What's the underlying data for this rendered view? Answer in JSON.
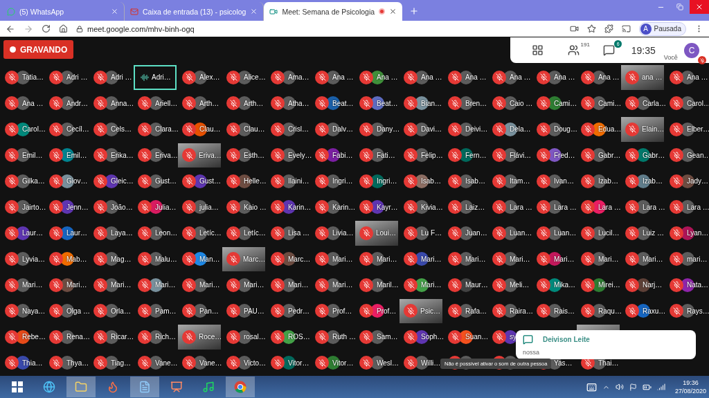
{
  "browser": {
    "tabs": [
      {
        "title": "(5) WhatsApp",
        "kind": "chat",
        "selected": false,
        "recording": false
      },
      {
        "title": "Caixa de entrada (13) - psicolog",
        "kind": "mail",
        "selected": false,
        "recording": false
      },
      {
        "title": "Meet: Semana de Psicologia",
        "kind": "meet",
        "selected": true,
        "recording": true
      }
    ],
    "url": "meet.google.com/mhv-binh-ogq",
    "profile": {
      "initial": "A",
      "label": "Pausada"
    }
  },
  "meeting": {
    "recording_label": "GRAVANDO",
    "participants_count": "191",
    "chat_badge": "6",
    "time": "19:35",
    "self": {
      "initial": "C",
      "label": "Você"
    },
    "grid": [
      [
        {
          "name": "Tatia…",
          "kind": "photo"
        },
        {
          "name": "Adri …",
          "kind": "photo"
        },
        {
          "name": "Adri …",
          "kind": "photo"
        },
        {
          "name": "Adri…",
          "kind": "speaking"
        },
        {
          "name": "Alex…",
          "kind": "photo"
        },
        {
          "name": "Alice…",
          "kind": "photo"
        },
        {
          "name": "Ama…",
          "kind": "photo"
        },
        {
          "name": "Ana …",
          "kind": "photo"
        },
        {
          "name": "Ana …",
          "kind": "letter",
          "color": "#3f8f3a"
        },
        {
          "name": "Ana …",
          "kind": "photo"
        },
        {
          "name": "Ana …",
          "kind": "photo"
        },
        {
          "name": "Ana …",
          "kind": "photo"
        },
        {
          "name": "Ana …",
          "kind": "photo"
        },
        {
          "name": "Ana …",
          "kind": "photo"
        },
        {
          "name": "ana …",
          "kind": "video"
        },
        {
          "name": "Ana …",
          "kind": "photo"
        }
      ],
      [
        {
          "name": "Ana …",
          "kind": "photo"
        },
        {
          "name": "Andr…",
          "kind": "photo"
        },
        {
          "name": "Anna…",
          "kind": "photo"
        },
        {
          "name": "Ariell…",
          "kind": "photo"
        },
        {
          "name": "Arth…",
          "kind": "photo"
        },
        {
          "name": "Arth…",
          "kind": "photo"
        },
        {
          "name": "Atha…",
          "kind": "photo"
        },
        {
          "name": "Beat…",
          "kind": "letter",
          "color": "#1a5fa8"
        },
        {
          "name": "Beat…",
          "kind": "letter",
          "color": "#5c6bc0"
        },
        {
          "name": "Bian…",
          "kind": "letter",
          "color": "#78909c"
        },
        {
          "name": "Bren…",
          "kind": "photo"
        },
        {
          "name": "Caio …",
          "kind": "photo"
        },
        {
          "name": "Cami…",
          "kind": "letter",
          "color": "#2e7d32"
        },
        {
          "name": "Cami…",
          "kind": "photo"
        },
        {
          "name": "Carla…",
          "kind": "photo"
        },
        {
          "name": "Carol…",
          "kind": "photo"
        }
      ],
      [
        {
          "name": "Carol…",
          "kind": "letter",
          "color": "#00897b"
        },
        {
          "name": "Cecíl…",
          "kind": "photo"
        },
        {
          "name": "Cels…",
          "kind": "photo"
        },
        {
          "name": "Clara…",
          "kind": "photo"
        },
        {
          "name": "Clau…",
          "kind": "letter",
          "color": "#e65100"
        },
        {
          "name": "Clau…",
          "kind": "photo"
        },
        {
          "name": "Crisl…",
          "kind": "photo"
        },
        {
          "name": "Dalv…",
          "kind": "photo"
        },
        {
          "name": "Dany…",
          "kind": "photo"
        },
        {
          "name": "Davi…",
          "kind": "photo"
        },
        {
          "name": "Deivi…",
          "kind": "photo"
        },
        {
          "name": "Dela…",
          "kind": "letter",
          "color": "#78909c"
        },
        {
          "name": "Doug…",
          "kind": "photo"
        },
        {
          "name": "Edua…",
          "kind": "letter",
          "color": "#ef6c00"
        },
        {
          "name": "Elain…",
          "kind": "video"
        },
        {
          "name": "Elber…",
          "kind": "photo"
        }
      ],
      [
        {
          "name": "Emil…",
          "kind": "photo"
        },
        {
          "name": "Emil…",
          "kind": "letter",
          "color": "#00838f"
        },
        {
          "name": "Erika…",
          "kind": "photo"
        },
        {
          "name": "Eriva…",
          "kind": "photo"
        },
        {
          "name": "Eriva…",
          "kind": "video"
        },
        {
          "name": "Esth…",
          "kind": "photo"
        },
        {
          "name": "Evely…",
          "kind": "photo"
        },
        {
          "name": "Fabi…",
          "kind": "letter",
          "color": "#7b1fa2"
        },
        {
          "name": "Fati…",
          "kind": "photo"
        },
        {
          "name": "Felip…",
          "kind": "photo"
        },
        {
          "name": "Fern…",
          "kind": "letter",
          "color": "#00695c"
        },
        {
          "name": "Flávi…",
          "kind": "photo"
        },
        {
          "name": "Fred…",
          "kind": "letter",
          "color": "#7e57c2"
        },
        {
          "name": "Gabr…",
          "kind": "photo"
        },
        {
          "name": "Gabr…",
          "kind": "letter",
          "color": "#00796b"
        },
        {
          "name": "Gean…",
          "kind": "photo"
        }
      ],
      [
        {
          "name": "Gilka…",
          "kind": "photo"
        },
        {
          "name": "Giov…",
          "kind": "letter",
          "color": "#78909c"
        },
        {
          "name": "Gleic…",
          "kind": "letter",
          "color": "#5e35b1"
        },
        {
          "name": "Gust…",
          "kind": "photo"
        },
        {
          "name": "Gust…",
          "kind": "letter",
          "color": "#5e35b1"
        },
        {
          "name": "Helle…",
          "kind": "letter",
          "color": "#6d4c41"
        },
        {
          "name": "Ilaini…",
          "kind": "photo"
        },
        {
          "name": "Ingri…",
          "kind": "photo"
        },
        {
          "name": "Ingri…",
          "kind": "letter",
          "color": "#00695c"
        },
        {
          "name": "Isab…",
          "kind": "letter",
          "color": "#8d6e63"
        },
        {
          "name": "Isab…",
          "kind": "photo"
        },
        {
          "name": "Itam…",
          "kind": "photo"
        },
        {
          "name": "Ivan…",
          "kind": "photo"
        },
        {
          "name": "Izab…",
          "kind": "photo"
        },
        {
          "name": "Izab…",
          "kind": "letter",
          "color": "#607d8b"
        },
        {
          "name": "Jady…",
          "kind": "letter",
          "color": "#6d4c41"
        }
      ],
      [
        {
          "name": "Jairto…",
          "kind": "photo"
        },
        {
          "name": "Jenn…",
          "kind": "letter",
          "color": "#5e35b1"
        },
        {
          "name": "João…",
          "kind": "photo"
        },
        {
          "name": "Julia…",
          "kind": "letter",
          "color": "#d81b60"
        },
        {
          "name": "julia…",
          "kind": "photo"
        },
        {
          "name": "Kaio …",
          "kind": "photo"
        },
        {
          "name": "Karin…",
          "kind": "letter",
          "color": "#5e35b1"
        },
        {
          "name": "Karin…",
          "kind": "photo"
        },
        {
          "name": "Kayr…",
          "kind": "letter",
          "color": "#5e35b1"
        },
        {
          "name": "Kivia…",
          "kind": "photo"
        },
        {
          "name": "Laiz…",
          "kind": "photo"
        },
        {
          "name": "Lara …",
          "kind": "photo"
        },
        {
          "name": "Lara …",
          "kind": "photo"
        },
        {
          "name": "Lara …",
          "kind": "letter",
          "color": "#e91e63"
        },
        {
          "name": "Lara …",
          "kind": "photo"
        },
        {
          "name": "Lara …",
          "kind": "photo"
        }
      ],
      [
        {
          "name": "Laur…",
          "kind": "letter",
          "color": "#5e35b1"
        },
        {
          "name": "Laur…",
          "kind": "letter",
          "color": "#1565c0"
        },
        {
          "name": "Laya…",
          "kind": "photo"
        },
        {
          "name": "Leon…",
          "kind": "photo"
        },
        {
          "name": "Letíc…",
          "kind": "photo"
        },
        {
          "name": "Letíc…",
          "kind": "photo"
        },
        {
          "name": "Lisa …",
          "kind": "photo"
        },
        {
          "name": "Livia…",
          "kind": "photo"
        },
        {
          "name": "Loui…",
          "kind": "video"
        },
        {
          "name": "Lu F…",
          "kind": "photo"
        },
        {
          "name": "Juan…",
          "kind": "photo"
        },
        {
          "name": "Luan…",
          "kind": "photo"
        },
        {
          "name": "Luan…",
          "kind": "photo"
        },
        {
          "name": "Lucil…",
          "kind": "photo"
        },
        {
          "name": "Luiz …",
          "kind": "photo"
        },
        {
          "name": "Lyan…",
          "kind": "letter",
          "color": "#ad1457"
        }
      ],
      [
        {
          "name": "Lyvia…",
          "kind": "photo"
        },
        {
          "name": "Mab…",
          "kind": "letter",
          "color": "#ef6c00"
        },
        {
          "name": "Mag…",
          "kind": "photo"
        },
        {
          "name": "Malu…",
          "kind": "photo"
        },
        {
          "name": "Man…",
          "kind": "letter",
          "color": "#1e88e5"
        },
        {
          "name": "Marc…",
          "kind": "video"
        },
        {
          "name": "Marc…",
          "kind": "letter",
          "color": "#6d4c41"
        },
        {
          "name": "Mari…",
          "kind": "photo"
        },
        {
          "name": "Mari…",
          "kind": "photo"
        },
        {
          "name": "Mari…",
          "kind": "letter",
          "color": "#3949ab"
        },
        {
          "name": "Mari…",
          "kind": "photo"
        },
        {
          "name": "Mari…",
          "kind": "photo"
        },
        {
          "name": "Mari…",
          "kind": "letter",
          "color": "#c2185b"
        },
        {
          "name": "Mari…",
          "kind": "photo"
        },
        {
          "name": "Mari…",
          "kind": "photo"
        },
        {
          "name": "mari…",
          "kind": "photo"
        }
      ],
      [
        {
          "name": "Mari…",
          "kind": "photo"
        },
        {
          "name": "Mari…",
          "kind": "letter",
          "color": "#6d4c41"
        },
        {
          "name": "Mari…",
          "kind": "photo"
        },
        {
          "name": "Mari…",
          "kind": "letter",
          "color": "#78909c"
        },
        {
          "name": "Mari…",
          "kind": "photo"
        },
        {
          "name": "Mari…",
          "kind": "photo"
        },
        {
          "name": "Mari…",
          "kind": "photo"
        },
        {
          "name": "Mari…",
          "kind": "photo"
        },
        {
          "name": "Maril…",
          "kind": "photo"
        },
        {
          "name": "Mari…",
          "kind": "letter",
          "color": "#43a047"
        },
        {
          "name": "Maur…",
          "kind": "letter",
          "color": "#424242"
        },
        {
          "name": "Meli…",
          "kind": "photo"
        },
        {
          "name": "Mika…",
          "kind": "letter",
          "color": "#00897b"
        },
        {
          "name": "Mirei…",
          "kind": "letter",
          "color": "#2e7d32"
        },
        {
          "name": "Narj…",
          "kind": "letter",
          "color": "#5d4037"
        },
        {
          "name": "Nata…",
          "kind": "letter",
          "color": "#8e24aa"
        }
      ],
      [
        {
          "name": "Naya…",
          "kind": "photo"
        },
        {
          "name": "Olga …",
          "kind": "photo"
        },
        {
          "name": "Orla…",
          "kind": "photo"
        },
        {
          "name": "Pam…",
          "kind": "photo"
        },
        {
          "name": "Pan…",
          "kind": "photo"
        },
        {
          "name": "PAU…",
          "kind": "photo"
        },
        {
          "name": "Pedr…",
          "kind": "photo"
        },
        {
          "name": "Prof…",
          "kind": "photo"
        },
        {
          "name": "Prof…",
          "kind": "letter",
          "color": "#e91e63"
        },
        {
          "name": "Psic…",
          "kind": "video"
        },
        {
          "name": "Rafa…",
          "kind": "photo"
        },
        {
          "name": "Raira…",
          "kind": "photo"
        },
        {
          "name": "Rais…",
          "kind": "photo"
        },
        {
          "name": "Raqu…",
          "kind": "photo"
        },
        {
          "name": "Raxu…",
          "kind": "letter",
          "color": "#1565c0"
        },
        {
          "name": "Rays…",
          "kind": "photo"
        }
      ],
      [
        {
          "name": "Rebe…",
          "kind": "letter",
          "color": "#e64a19"
        },
        {
          "name": "Rena…",
          "kind": "photo"
        },
        {
          "name": "Ricar…",
          "kind": "photo"
        },
        {
          "name": "Rich…",
          "kind": "photo"
        },
        {
          "name": "Roce…",
          "kind": "video"
        },
        {
          "name": "rosal…",
          "kind": "photo"
        },
        {
          "name": "ROS…",
          "kind": "letter",
          "color": "#43a047"
        },
        {
          "name": "Ruth …",
          "kind": "photo"
        },
        {
          "name": "Sam…",
          "kind": "photo"
        },
        {
          "name": "Soph…",
          "kind": "letter",
          "color": "#5e35b1"
        },
        {
          "name": "Suan…",
          "kind": "letter",
          "color": "#f4511e"
        },
        {
          "name": "sy",
          "kind": "letter",
          "color": "#5e35b1"
        },
        {
          "kind": "covered"
        },
        {
          "kind": "video"
        }
      ],
      [
        {
          "name": "Thia…",
          "kind": "letter",
          "color": "#3949ab"
        },
        {
          "name": "Thya…",
          "kind": "photo"
        },
        {
          "name": "Tiag…",
          "kind": "photo"
        },
        {
          "name": "Vane…",
          "kind": "photo"
        },
        {
          "name": "Vane…",
          "kind": "photo"
        },
        {
          "name": "Victo…",
          "kind": "photo"
        },
        {
          "name": "Vitor…",
          "kind": "letter",
          "color": "#00695c"
        },
        {
          "name": "Vitor…",
          "kind": "letter",
          "color": "#2e7d32"
        },
        {
          "name": "Wesl…",
          "kind": "photo"
        },
        {
          "name": "Willi…",
          "kind": "photo"
        },
        {
          "kind": "photo"
        },
        {
          "kind": "photo"
        },
        {
          "name": "Yas…",
          "kind": "photo"
        },
        {
          "name": "Thai…",
          "kind": "photo"
        }
      ]
    ],
    "tooltip": "Não é possível ativar o som de outra pessoa",
    "notification": {
      "sender": "Deivison Leite",
      "message": "nossa"
    }
  },
  "taskbar": {
    "apps": [
      {
        "kind": "start",
        "selected": false
      },
      {
        "kind": "globe",
        "selected": false
      },
      {
        "kind": "folder",
        "selected": true
      },
      {
        "kind": "fox",
        "selected": false
      },
      {
        "kind": "document",
        "selected": true
      },
      {
        "kind": "slides",
        "selected": false
      },
      {
        "kind": "music",
        "selected": false
      },
      {
        "kind": "chrome",
        "selected": true
      }
    ],
    "time": "19:36",
    "date": "27/08/2020"
  }
}
